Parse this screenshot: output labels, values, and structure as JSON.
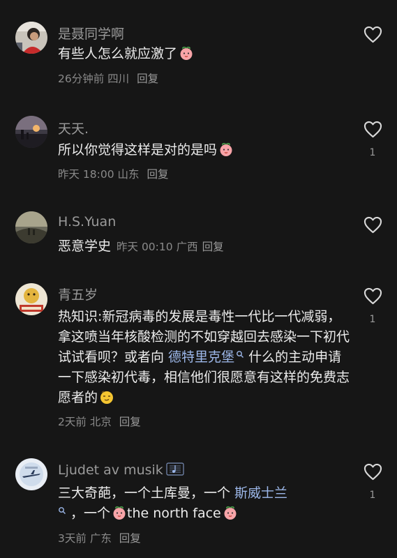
{
  "comments": [
    {
      "username": "是聂同学啊",
      "text": "有些人怎么就应激了",
      "emoji": "crying-face-emoji",
      "time": "26分钟前",
      "location": "四川",
      "reply": "回复",
      "likes": ""
    },
    {
      "username": "天天.",
      "text": "所以你觉得这样是对的是吗",
      "emoji": "shushing-face-emoji",
      "time": "昨天 18:00",
      "location": "山东",
      "reply": "回复",
      "likes": "1"
    },
    {
      "username": "H.S.Yuan",
      "text": "恶意学史",
      "time": "昨天 00:10",
      "location": "广西",
      "reply": "回复",
      "likes": ""
    },
    {
      "username": "青五岁",
      "text_part1": "热知识:新冠病毒的发展是毒性一代比一代减弱，拿这喷当年核酸检测的不如穿越回去感染一下初代试试看呗？或者向 ",
      "link": "德特里克堡",
      "text_part2": " 什么的主动申请一下感染初代毒，相信他们很愿意有这样的免费志愿者的",
      "emoji": "smirk-face-emoji",
      "time": "2天前",
      "location": "北京",
      "reply": "回复",
      "likes": "1"
    },
    {
      "username": "Ljudet av musik",
      "badge": "music-note-icon",
      "text_part1": "三大奇葩，一个土库曼，一个 ",
      "link": "斯威士兰",
      "text_part2": " ，一个",
      "text_part3": "the north face",
      "emoji": "laughing-face-emoji",
      "time": "3天前",
      "location": "广东",
      "reply": "回复",
      "likes": "1"
    }
  ],
  "colors": {
    "background": "#161616",
    "text": "#ececec",
    "secondary": "#8a8a8a",
    "link": "#9db8ea"
  }
}
